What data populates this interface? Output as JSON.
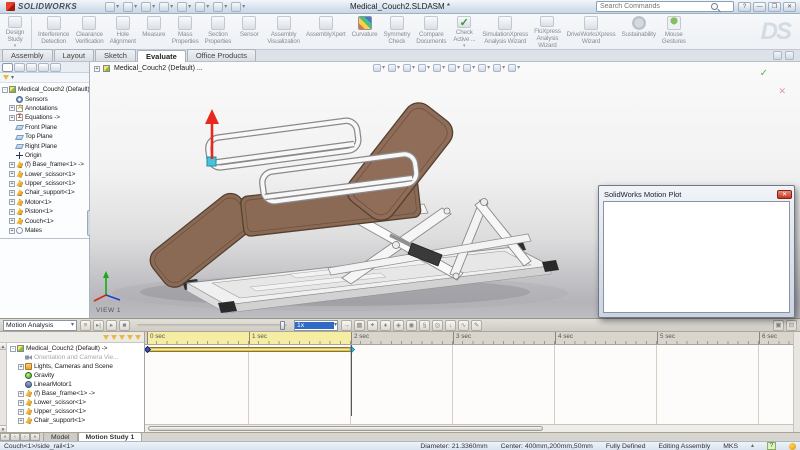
{
  "titlebar": {
    "app_name": "SOLIDWORKS",
    "document_title": "Medical_Couch2.SLDASM *",
    "search_placeholder": "Search Commands",
    "qat": [
      {
        "icon": "new-document",
        "arrow": true
      },
      {
        "icon": "open-document",
        "arrow": true
      },
      {
        "icon": "save",
        "arrow": true
      },
      {
        "icon": "print",
        "arrow": true
      },
      {
        "icon": "undo",
        "arrow": true
      },
      {
        "icon": "select",
        "arrow": true
      },
      {
        "icon": "rebuild",
        "arrow": false
      },
      {
        "icon": "options",
        "arrow": true
      }
    ],
    "window_buttons": [
      {
        "icon": "help",
        "glyph": "?"
      },
      {
        "icon": "minimize",
        "glyph": "—"
      },
      {
        "icon": "restore",
        "glyph": "❐"
      },
      {
        "icon": "close",
        "glyph": "✕"
      }
    ]
  },
  "ribbon": {
    "buttons": [
      {
        "label": "Design\nStudy",
        "icon": "design-study",
        "arrow": true,
        "sep": true
      },
      {
        "label": "Interference\nDetection",
        "icon": "interference-detection"
      },
      {
        "label": "Clearance\nVerification",
        "icon": "clearance-verification"
      },
      {
        "label": "Hole\nAlignment",
        "icon": "hole-alignment"
      },
      {
        "label": "Measure",
        "icon": "measure"
      },
      {
        "label": "Mass\nProperties",
        "icon": "mass-properties"
      },
      {
        "label": "Section\nProperties",
        "icon": "section-properties"
      },
      {
        "label": "Sensor",
        "icon": "sensor"
      },
      {
        "label": "Assembly\nVisualization",
        "icon": "assembly-visualization"
      },
      {
        "label": "AssemblyXpert",
        "icon": "assemblyxpert"
      },
      {
        "label": "Curvature",
        "icon": "curvature"
      },
      {
        "label": "Symmetry\nCheck",
        "icon": "symmetry-check"
      },
      {
        "label": "Compare\nDocuments",
        "icon": "compare-documents"
      },
      {
        "label": "Check\nActive ...",
        "icon": "check",
        "arrow": true
      },
      {
        "label": "SimulationXpress\nAnalysis Wizard",
        "icon": "simulationxpress"
      },
      {
        "label": "FloXpress\nAnalysis\nWizard",
        "icon": "floxpress"
      },
      {
        "label": "DriveWorksXpress\nWizard",
        "icon": "driveworksxpress"
      },
      {
        "label": "Sustainability",
        "icon": "sustain"
      },
      {
        "label": "Mouse\nGestures",
        "icon": "mouse"
      }
    ]
  },
  "command_tabs": {
    "tabs": [
      {
        "label": "Assembly"
      },
      {
        "label": "Layout"
      },
      {
        "label": "Sketch"
      },
      {
        "label": "Evaluate",
        "active": true
      },
      {
        "label": "Office Products"
      }
    ]
  },
  "feature_tree": {
    "rows": [
      {
        "e": "-",
        "icon": "asm",
        "label": "Medical_Couch2 (Default) ->",
        "ind": 0
      },
      {
        "icon": "sensors",
        "label": "Sensors",
        "ind": 1
      },
      {
        "e": "+",
        "icon": "annot",
        "label": "Annotations",
        "ind": 1
      },
      {
        "e": "+",
        "icon": "eq",
        "label": "Equations ->",
        "ind": 1
      },
      {
        "icon": "plane",
        "label": "Front Plane",
        "ind": 1
      },
      {
        "icon": "plane",
        "label": "Top Plane",
        "ind": 1
      },
      {
        "icon": "plane",
        "label": "Right Plane",
        "ind": 1
      },
      {
        "icon": "origin",
        "label": "Origin",
        "ind": 1
      },
      {
        "e": "+",
        "icon": "part",
        "label": "(f) Base_frame<1> ->",
        "ind": 1
      },
      {
        "e": "+",
        "icon": "part",
        "label": "Lower_scissor<1>",
        "ind": 1
      },
      {
        "e": "+",
        "icon": "part",
        "label": "Upper_scissor<1>",
        "ind": 1
      },
      {
        "e": "+",
        "icon": "part",
        "label": "Chair_support<1>",
        "ind": 1
      },
      {
        "e": "+",
        "icon": "part",
        "label": "Motor<1>",
        "ind": 1
      },
      {
        "e": "+",
        "icon": "part",
        "label": "Piston<1>",
        "ind": 1
      },
      {
        "e": "+",
        "icon": "part",
        "label": "Couch<1>",
        "ind": 1
      },
      {
        "e": "+",
        "icon": "mates",
        "label": "Mates",
        "ind": 1
      }
    ]
  },
  "viewport": {
    "breadcrumb": "Medical_Couch2 (Default) ...",
    "view_label": "VIEW 1",
    "headsup": [
      {
        "icon": "zoom-fit"
      },
      {
        "icon": "zoom-area"
      },
      {
        "icon": "previous-view"
      },
      {
        "icon": "section-view"
      },
      {
        "icon": "view-orientation",
        "arrow": true
      },
      {
        "icon": "display-style",
        "arrow": true
      },
      {
        "icon": "hide-show-items",
        "arrow": true
      },
      {
        "icon": "edit-appearance",
        "arrow": true
      },
      {
        "icon": "apply-scene",
        "arrow": true
      },
      {
        "icon": "view-settings",
        "arrow": true
      }
    ]
  },
  "motion_plot": {
    "title": "SolidWorks Motion Plot",
    "close_glyph": "✕"
  },
  "motion_toolbar": {
    "study_type": "Motion Analysis",
    "speed": "1x",
    "left_icons": [
      {
        "icon": "calculate",
        "glyph": "≡"
      },
      {
        "icon": "play-from-start",
        "glyph": "▸|"
      },
      {
        "icon": "play",
        "glyph": "▸"
      },
      {
        "icon": "stop",
        "glyph": "■"
      }
    ],
    "right_icons": [
      {
        "icon": "playback-mode",
        "glyph": "→"
      },
      {
        "icon": "save-animation",
        "glyph": "▦"
      },
      {
        "icon": "animation-wizard",
        "glyph": "✦"
      },
      {
        "icon": "auto-key",
        "glyph": "♦"
      },
      {
        "icon": "add-key",
        "glyph": "◈"
      },
      {
        "icon": "motor",
        "glyph": "◉"
      },
      {
        "icon": "spring",
        "glyph": "§"
      },
      {
        "icon": "contact",
        "glyph": "◎"
      },
      {
        "icon": "gravity",
        "glyph": "↓"
      },
      {
        "icon": "results-and-plots",
        "glyph": "∿"
      },
      {
        "icon": "motion-study-properties",
        "glyph": "✎"
      }
    ],
    "corner_icons": [
      {
        "icon": "zoom-in-timeline",
        "glyph": "▣"
      },
      {
        "icon": "zoom-out-timeline",
        "glyph": "⊟"
      }
    ]
  },
  "motion_tree": {
    "rows": [
      {
        "e": "-",
        "icon": "asm",
        "label": "Medical_Couch2 (Default) ->",
        "ind": 0,
        "key0": "black",
        "line": true,
        "endkey": "cyan",
        "ekt": 2
      },
      {
        "icon": "cam",
        "label": "Orientation and Camera Vie...",
        "ind": 1,
        "dim": true,
        "key0": "gray"
      },
      {
        "e": "+",
        "icon": "scene",
        "label": "Lights, Cameras and Scene",
        "ind": 1,
        "key0": "gray"
      },
      {
        "icon": "grav",
        "label": "Gravity",
        "ind": 1,
        "key0": "blue",
        "bar": "gold",
        "s": 0,
        "eN": 2
      },
      {
        "icon": "motor",
        "label": "LinearMotor1",
        "ind": 1,
        "key0": "blue",
        "bar": "gold",
        "s": 0,
        "eN": 2
      },
      {
        "e": "+",
        "icon": "part",
        "label": "(f) Base_frame<1> ->",
        "ind": 1,
        "key0": "blue",
        "bar": "yellow",
        "s": 0,
        "eN": 2
      },
      {
        "e": "+",
        "icon": "part",
        "label": "Lower_scissor<1>",
        "ind": 1,
        "key0": "blue",
        "bar": "yellow",
        "s": 0,
        "eN": 2
      },
      {
        "e": "+",
        "icon": "part",
        "label": "Upper_scissor<1>",
        "ind": 1,
        "key0": "blue",
        "bar": "yellow",
        "s": 0,
        "eN": 2
      },
      {
        "e": "+",
        "icon": "part",
        "label": "Chair_support<1>",
        "ind": 1,
        "key0": "blue",
        "bar": "yellow",
        "s": 0,
        "eN": 2
      }
    ]
  },
  "timeline": {
    "ticks": [
      {
        "label": "0 sec",
        "t": 0
      },
      {
        "label": "1 sec",
        "t": 1
      },
      {
        "label": "2 sec",
        "t": 2
      },
      {
        "label": "3 sec",
        "t": 3
      },
      {
        "label": "4 sec",
        "t": 4
      },
      {
        "label": "5 sec",
        "t": 5
      },
      {
        "label": "6 sec",
        "t": 6
      }
    ],
    "active_start_sec": 0,
    "active_end_sec": 2,
    "playhead_sec": 2
  },
  "bottom_tabs": {
    "nav": [
      {
        "icon": "first-sheet",
        "glyph": "«"
      },
      {
        "icon": "previous-sheet",
        "glyph": "‹"
      },
      {
        "icon": "next-sheet",
        "glyph": "›"
      },
      {
        "icon": "last-sheet",
        "glyph": "»"
      }
    ],
    "tabs": [
      {
        "label": "Model"
      },
      {
        "label": "Motion Study 1",
        "active": true
      }
    ]
  },
  "statusbar": {
    "message": "Couch<1>/side_rail<1>",
    "items": [
      "Diameter: 21.3360mm",
      "Center: 400mm,200mm,50mm",
      "Fully Defined",
      "Editing Assembly",
      "MKS"
    ]
  }
}
